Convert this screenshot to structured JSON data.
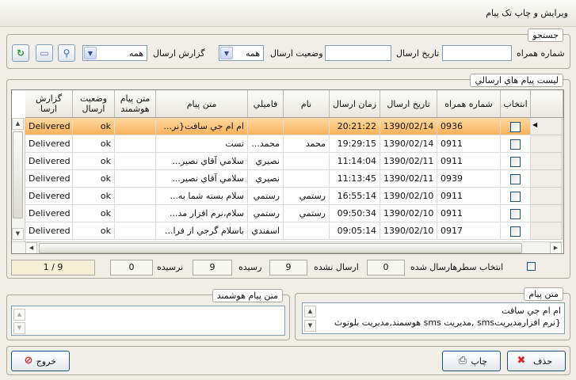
{
  "window": {
    "title": "ويرايش و چاپ تک پيام"
  },
  "search": {
    "legend": "جستجو",
    "phone_label": "شماره همراه",
    "phone_value": "",
    "date_label": "تاريخ ارسال",
    "date_value": "",
    "status_label": "وضعيت ارسال",
    "status_value": "همه",
    "report_label": "گزارش ارسال",
    "report_value": "همه"
  },
  "list": {
    "legend": "ليست پيام هاي ارسالي",
    "columns": [
      "انتخاب",
      "شماره همراه",
      "تاريخ ارسال",
      "زمان ارسال",
      "نام",
      "فاميلي",
      "متن پيام",
      "متن پيام هوشمند",
      "وضعيت ارسال",
      "گزارش ارسا"
    ],
    "rows": [
      {
        "phone": "0936",
        "date": "1390/02/14",
        "time": "20:21:22",
        "name": "",
        "family": "",
        "message": "ام ام جي سافت{نر...",
        "smart": "",
        "status": "ok",
        "report": "Delivered"
      },
      {
        "phone": "0911",
        "date": "1390/02/14",
        "time": "19:29:15",
        "name": "محمد",
        "family": "محمد...",
        "message": "تست",
        "smart": "",
        "status": "ok",
        "report": "Delivered"
      },
      {
        "phone": "0911",
        "date": "1390/02/11",
        "time": "11:14:04",
        "name": "",
        "family": "نصيري",
        "message": "سلامي آقاي نصير...",
        "smart": "",
        "status": "ok",
        "report": "Delivered"
      },
      {
        "phone": "0939",
        "date": "1390/02/11",
        "time": "11:13:45",
        "name": "",
        "family": "نصيري",
        "message": "سلامي آقاي نصير...",
        "smart": "",
        "status": "ok",
        "report": "Delivered"
      },
      {
        "phone": "0911",
        "date": "1390/02/10",
        "time": "16:55:14",
        "name": "رستمي",
        "family": "رستمي",
        "message": "سلام بسته شما به...",
        "smart": "",
        "status": "ok",
        "report": "Delivered"
      },
      {
        "phone": "0911",
        "date": "1390/02/10",
        "time": "09:50:34",
        "name": "رستمي",
        "family": "رستمي",
        "message": "سلام،نرم افزار مد...",
        "smart": "",
        "status": "ok",
        "report": "Delivered"
      },
      {
        "phone": "0917",
        "date": "1390/02/10",
        "time": "09:05:14",
        "name": "",
        "family": "اسفندي",
        "message": "باسلام گرجي از فرا...",
        "smart": "",
        "status": "ok",
        "report": "Delivered"
      }
    ]
  },
  "summary": {
    "select_rows_label": "انتخاب سطرها",
    "sent_label": "ارسال شده",
    "sent_value": "0",
    "not_sent_label": "ارسال نشده",
    "not_sent_value": "9",
    "delivered_label": "رسيده",
    "delivered_value": "9",
    "not_delivered_label": "نرسيده",
    "not_delivered_value": "0",
    "pager": "1 / 9"
  },
  "message_panel": {
    "legend": "متن پيام",
    "line1": "ام ام جي سافت",
    "line2": "{نرم افزارمديريتsms ,مديريت sms هوسمند,مديريت بلوتوث"
  },
  "smart_panel": {
    "legend": "متن پيام هوشمند"
  },
  "buttons": {
    "delete": "حذف",
    "print": "چاپ",
    "exit": "خروج"
  },
  "colors": {
    "selected_row": "#f7b25a",
    "border": "#7f9db9"
  }
}
